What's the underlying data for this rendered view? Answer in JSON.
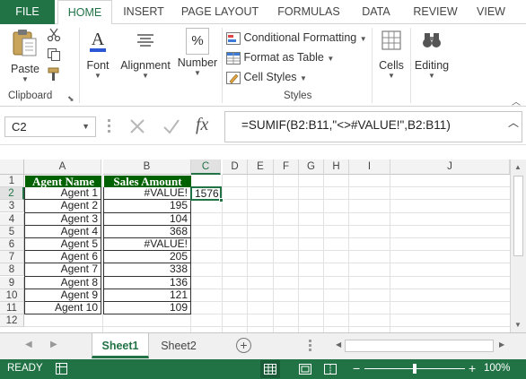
{
  "ribbon_tabs": [
    "FILE",
    "HOME",
    "INSERT",
    "PAGE LAYOUT",
    "FORMULAS",
    "DATA",
    "REVIEW",
    "VIEW"
  ],
  "ribbon": {
    "clipboard": {
      "paste": "Paste",
      "label": "Clipboard"
    },
    "font": {
      "label": "Font"
    },
    "alignment": {
      "label": "Alignment"
    },
    "number": {
      "label": "Number",
      "symbol": "%"
    },
    "styles": {
      "conditional_formatting": "Conditional Formatting",
      "format_as_table": "Format as Table",
      "cell_styles": "Cell Styles",
      "label": "Styles"
    },
    "cells": {
      "label": "Cells"
    },
    "editing": {
      "label": "Editing"
    }
  },
  "formula_bar": {
    "name_box": "C2",
    "fx": "fx",
    "formula": "=SUMIF(B2:B11,\"<>#VALUE!\",B2:B11)"
  },
  "columns": [
    "A",
    "B",
    "C",
    "D",
    "E",
    "F",
    "G",
    "H",
    "I",
    "J"
  ],
  "rows": [
    "1",
    "2",
    "3",
    "4",
    "5",
    "6",
    "7",
    "8",
    "9",
    "10",
    "11",
    "12"
  ],
  "table": {
    "headers": [
      "Agent Name",
      "Sales Amount"
    ],
    "rows": [
      [
        "Agent 1",
        "#VALUE!"
      ],
      [
        "Agent 2",
        "195"
      ],
      [
        "Agent 3",
        "104"
      ],
      [
        "Agent 4",
        "368"
      ],
      [
        "Agent 5",
        "#VALUE!"
      ],
      [
        "Agent 6",
        "205"
      ],
      [
        "Agent 7",
        "338"
      ],
      [
        "Agent 8",
        "136"
      ],
      [
        "Agent 9",
        "121"
      ],
      [
        "Agent 10",
        "109"
      ]
    ],
    "result_cell": "1576",
    "header_bg": "#006100"
  },
  "sheets": [
    "Sheet1",
    "Sheet2"
  ],
  "status": {
    "mode": "READY",
    "zoom": "100%"
  },
  "colors": {
    "accent": "#217346"
  }
}
